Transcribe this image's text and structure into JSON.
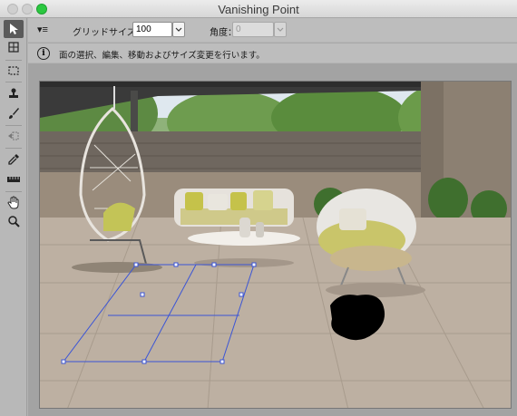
{
  "window": {
    "title": "Vanishing Point"
  },
  "toolbar": {
    "tools": [
      "edit-plane-tool",
      "create-plane-tool",
      "marquee-tool",
      "stamp-tool",
      "brush-tool",
      "transform-tool",
      "eyedropper-tool",
      "measure-tool",
      "hand-tool",
      "zoom-tool"
    ]
  },
  "options": {
    "menu_glyph": "▾≡",
    "grid_size_label": "グリッドサイズ：",
    "grid_size_value": "100",
    "angle_label": "角度：",
    "angle_value": "0"
  },
  "info": {
    "icon": "i",
    "text": "面の選択、編集、移動およびサイズ変更を行います。"
  },
  "colors": {
    "plane_grid": "#3b55d6",
    "close_active": "#2bc840"
  }
}
